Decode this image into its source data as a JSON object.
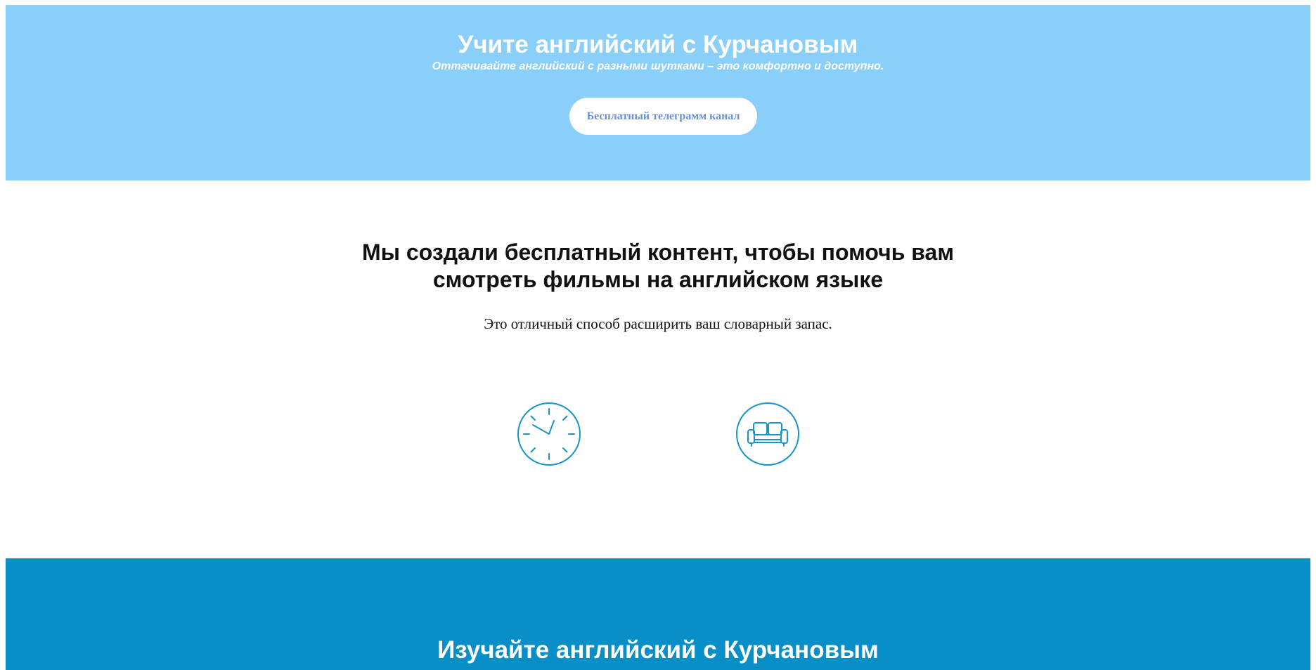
{
  "hero": {
    "title": "Учите английский с Курчановым",
    "subtitle": "Оттачивайте английский с разными шутками – это комфортно и доступно.",
    "button_label": "Бесплатный телеграмм канал"
  },
  "intro": {
    "heading_line1": "Мы создали бесплатный контент, чтобы помочь вам",
    "heading_line2": "смотреть фильмы на английском языке",
    "text": "Это отличный способ расширить ваш словарный запас."
  },
  "features": [
    {
      "icon": "clock-icon"
    },
    {
      "icon": "sofa-icon"
    }
  ],
  "footer": {
    "title": "Изучайте английский с Курчановым"
  },
  "colors": {
    "hero_background": "#89cff9",
    "button_text": "#6d8fd4",
    "icon_stroke": "#1a93c7",
    "footer_background": "#098fc7"
  }
}
